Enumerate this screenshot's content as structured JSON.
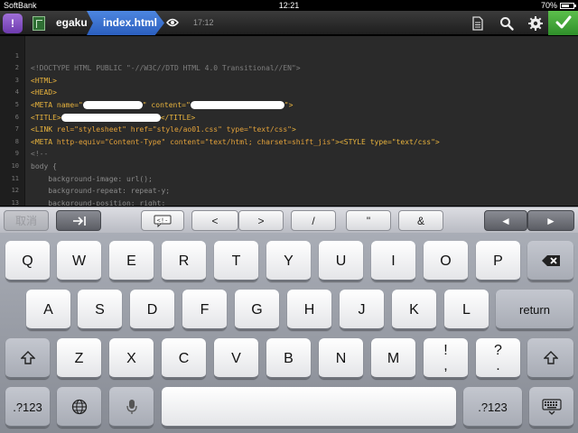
{
  "status_bar": {
    "carrier": "SoftBank",
    "time": "12:21",
    "battery": "70%",
    "battery_level": 0.7
  },
  "toolbar": {
    "app_initial": "!",
    "folder": "egaku",
    "file": "index.html",
    "time": "17:12"
  },
  "editor": {
    "lines": [
      {
        "n": "1",
        "text": "<!DOCTYPE HTML PUBLIC \"-//W3C//DTD HTML 4.0 Transitional//EN\">"
      },
      {
        "n": "2",
        "text": "<HTML>"
      },
      {
        "n": "3",
        "text": "<HEAD>"
      },
      {
        "n": "4",
        "pre": "<META name=\"",
        "mid": "\" content=\"",
        "post": "\">"
      },
      {
        "n": "5",
        "pre": "<TITLE>",
        "post": "</TITLE>"
      },
      {
        "n": "6",
        "pre": "<LINK ",
        "attrs": "rel=\"stylesheet\" href=\"style/ao01.css\" type=\"text/css\"",
        "post": ">"
      },
      {
        "n": "7",
        "pre": "<META ",
        "attrs": "http-equiv=\"Content-Type\" content=\"text/html; charset=shift_jis\"",
        "post": "><STYLE type=\"text/css\">"
      },
      {
        "n": "8",
        "text": "<!--"
      },
      {
        "n": "9",
        "text": "body {"
      },
      {
        "n": "10",
        "text": "    background-image: url();"
      },
      {
        "n": "11",
        "text": "    background-repeat: repeat-y;"
      },
      {
        "n": "12",
        "text": "    background-position: right;"
      },
      {
        "n": "13",
        "text": "}"
      }
    ]
  },
  "accessory": {
    "cancel": "取消",
    "lt": "<",
    "gt": ">",
    "slash": "/",
    "quote": "\"",
    "amp": "&",
    "left_arrow": "◄",
    "right_arrow": "►"
  },
  "keyboard": {
    "row1": [
      "Q",
      "W",
      "E",
      "R",
      "T",
      "Y",
      "U",
      "I",
      "O",
      "P"
    ],
    "row2": [
      "A",
      "S",
      "D",
      "F",
      "G",
      "H",
      "J",
      "K",
      "L"
    ],
    "row3": [
      "Z",
      "X",
      "C",
      "V",
      "B",
      "N",
      "M"
    ],
    "return": "return",
    "exclaim_comma": "!\n,",
    "question_period": "?\n.",
    "numbers": ".?123",
    "numbers_right": ".?123"
  }
}
